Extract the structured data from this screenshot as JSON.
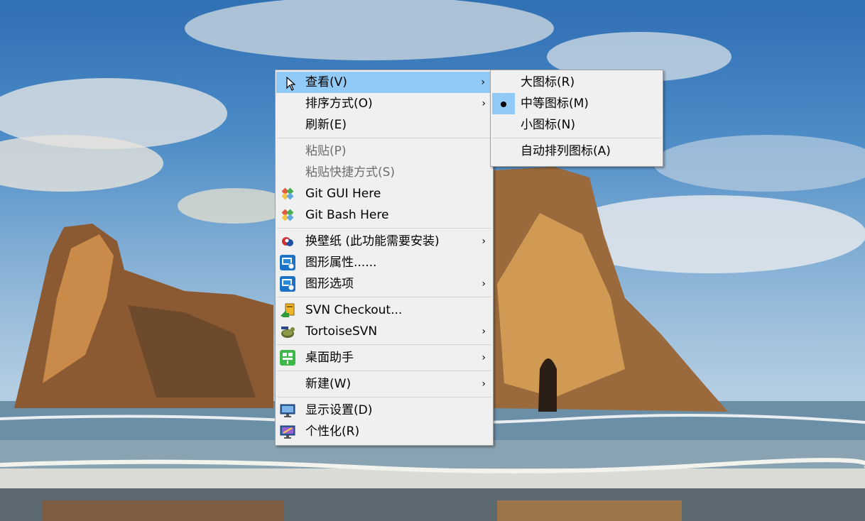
{
  "main_menu": {
    "items": [
      {
        "label": "查看(V)",
        "icon": "pointer-cursor-icon",
        "submenu": true,
        "highlighted": true
      },
      {
        "label": "排序方式(O)",
        "submenu": true
      },
      {
        "label": "刷新(E)"
      },
      {
        "label": "粘贴(P)",
        "disabled": true
      },
      {
        "label": "粘贴快捷方式(S)",
        "disabled": true
      },
      {
        "label": "Git GUI Here",
        "icon": "git-gui-icon"
      },
      {
        "label": "Git Bash Here",
        "icon": "git-bash-icon"
      },
      {
        "label": "换壁纸 (此功能需要安装)",
        "icon": "wallpaper-icon",
        "submenu": true
      },
      {
        "label": "图形属性......",
        "icon": "intel-graphics-icon"
      },
      {
        "label": "图形选项",
        "icon": "intel-graphics-icon",
        "submenu": true
      },
      {
        "label": "SVN Checkout...",
        "icon": "svn-checkout-icon"
      },
      {
        "label": "TortoiseSVN",
        "icon": "tortoisesvn-icon",
        "submenu": true
      },
      {
        "label": "桌面助手",
        "icon": "desktop-assistant-icon",
        "submenu": true
      },
      {
        "label": "新建(W)",
        "submenu": true
      },
      {
        "label": "显示设置(D)",
        "icon": "display-settings-icon"
      },
      {
        "label": "个性化(R)",
        "icon": "personalize-icon"
      }
    ]
  },
  "view_submenu": {
    "items": [
      {
        "label": "大图标(R)"
      },
      {
        "label": "中等图标(M)",
        "selected": true
      },
      {
        "label": "小图标(N)"
      },
      {
        "label": "自动排列图标(A)"
      }
    ]
  },
  "colors": {
    "highlight": "#91c9f7",
    "menu_bg": "#f0f0f0",
    "disabled_text": "#6d6d6d"
  }
}
